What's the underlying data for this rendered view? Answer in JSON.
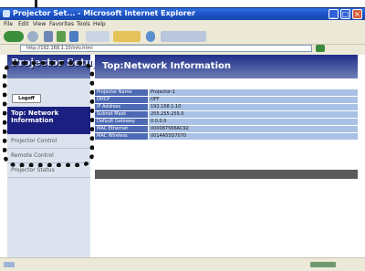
{
  "window": {
    "title": "Projector Set... - Microsoft Internet Explorer",
    "menu": [
      "File",
      "Edit",
      "View",
      "Favorites",
      "Tools",
      "Help"
    ],
    "address": "http://192.168.1.10/info.html",
    "controls": {
      "minimize": "_",
      "maximize": "□",
      "close": "×"
    }
  },
  "sidebar": {
    "title": "Projector Setup",
    "logoff_label": "Logoff",
    "active_item": "Top: Network Information",
    "items": [
      "Projector Control",
      "Remote Control",
      "Projector Status"
    ]
  },
  "main": {
    "title": "Top:Network Information",
    "rows": [
      {
        "label": "Projector Name",
        "value": "Projector-1"
      },
      {
        "label": "DHCP",
        "value": "OFF"
      },
      {
        "label": "IP Address",
        "value": "192.168.1.10"
      },
      {
        "label": "Subnet Mask",
        "value": "255.255.255.0"
      },
      {
        "label": "Default Gateway",
        "value": "0.0.0.0"
      },
      {
        "label": "MAC Ethernet",
        "value": "000087566AC92"
      },
      {
        "label": "MAC Wireless",
        "value": "0014A55D7070"
      }
    ]
  },
  "colors": {
    "header_gradient_top": "#1f2e8a",
    "active_nav": "#1a1f80",
    "label_bg": "#4d6ab4",
    "value_bg": "#a9c1e4"
  }
}
